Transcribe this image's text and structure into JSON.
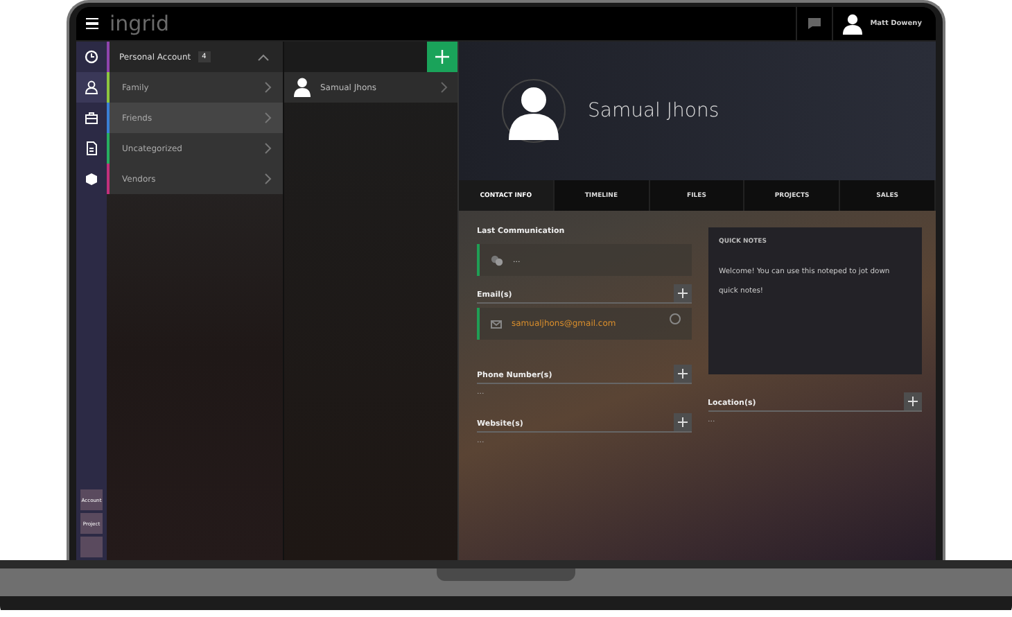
{
  "topbar": {
    "logo": "ingrid",
    "user_name": "Matt Doweny"
  },
  "rail": {
    "items": [
      {
        "kind": "clock",
        "selected": false
      },
      {
        "kind": "contacts",
        "selected": true
      },
      {
        "kind": "briefcase",
        "selected": false
      },
      {
        "kind": "document",
        "selected": false
      },
      {
        "kind": "box",
        "selected": false
      }
    ],
    "bottom_buttons": [
      "Account",
      "Project"
    ]
  },
  "groups": {
    "title": "Personal Account",
    "count": "4",
    "expanded": true,
    "items": [
      {
        "label": "Family",
        "color": "#8dc63f",
        "selected": false
      },
      {
        "label": "Friends",
        "color": "#3a7fd5",
        "selected": true
      },
      {
        "label": "Uncategorized",
        "color": "#27ae60",
        "selected": false
      },
      {
        "label": "Vendors",
        "color": "#c2307c",
        "selected": false
      }
    ]
  },
  "contacts": [
    {
      "name": "Samual Jhons",
      "selected": true
    }
  ],
  "profile": {
    "name": "Samual Jhons"
  },
  "tabs": [
    {
      "label": "CONTACT INFO",
      "selected": true
    },
    {
      "label": "TIMELINE",
      "selected": false
    },
    {
      "label": "FILES",
      "selected": false
    },
    {
      "label": "PROJECTS",
      "selected": false
    },
    {
      "label": "SALES",
      "selected": false
    }
  ],
  "last_communication": {
    "title": "Last Communication",
    "value": "..."
  },
  "emails": {
    "title": "Email(s)",
    "items": [
      {
        "address": "samualjhons@gmail.com",
        "selected": false
      }
    ]
  },
  "phones": {
    "title": "Phone Number(s)",
    "value": "..."
  },
  "websites": {
    "title": "Website(s)",
    "value": "..."
  },
  "quick_notes": {
    "title": "QUICK NOTES",
    "text": "Welcome! You can use this noteped to jot down quick notes!"
  },
  "locations": {
    "title": "Location(s)",
    "value": "..."
  }
}
